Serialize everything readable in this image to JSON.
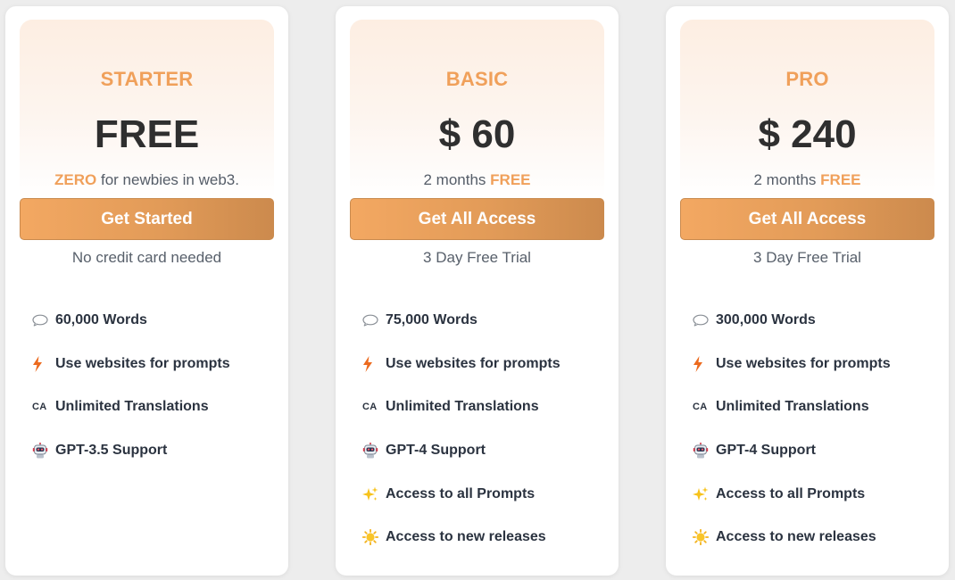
{
  "colors": {
    "accent": "#f0a05a",
    "button_start": "#f3a862",
    "button_end": "#cc8a4d",
    "text_dark": "#2b3340"
  },
  "plans": [
    {
      "name": "STARTER",
      "price": "FREE",
      "sub_highlight": "ZERO",
      "sub_text": " for newbies in web3.",
      "cta_label": "Get Started",
      "cta_note": "No credit card needed",
      "features": [
        {
          "icon": "speech-bubble-icon",
          "text": "60,000 Words"
        },
        {
          "icon": "lightning-icon",
          "text": "Use websites for prompts"
        },
        {
          "icon": "ca-translate-icon",
          "icon_text": "CA",
          "text": "Unlimited Translations"
        },
        {
          "icon": "robot-icon",
          "text": "GPT-3.5 Support"
        }
      ]
    },
    {
      "name": "BASIC",
      "price": "$ 60",
      "sub_text": "2 months ",
      "sub_highlight": "FREE",
      "cta_label": "Get All Access",
      "cta_note": "3 Day Free Trial",
      "features": [
        {
          "icon": "speech-bubble-icon",
          "text": "75,000 Words"
        },
        {
          "icon": "lightning-icon",
          "text": "Use websites for prompts"
        },
        {
          "icon": "ca-translate-icon",
          "icon_text": "CA",
          "text": "Unlimited Translations"
        },
        {
          "icon": "robot-icon",
          "text": "GPT-4 Support"
        },
        {
          "icon": "sparkles-icon",
          "text": "Access to all Prompts"
        },
        {
          "icon": "sun-icon",
          "text": "Access to new releases"
        }
      ]
    },
    {
      "name": "PRO",
      "price": "$ 240",
      "sub_text": "2 months ",
      "sub_highlight": "FREE",
      "cta_label": "Get All Access",
      "cta_note": "3 Day Free Trial",
      "features": [
        {
          "icon": "speech-bubble-icon",
          "text": "300,000 Words"
        },
        {
          "icon": "lightning-icon",
          "text": "Use websites for prompts"
        },
        {
          "icon": "ca-translate-icon",
          "icon_text": "CA",
          "text": "Unlimited Translations"
        },
        {
          "icon": "robot-icon",
          "text": "GPT-4 Support"
        },
        {
          "icon": "sparkles-icon",
          "text": "Access to all Prompts"
        },
        {
          "icon": "sun-icon",
          "text": "Access to new releases"
        }
      ]
    }
  ]
}
